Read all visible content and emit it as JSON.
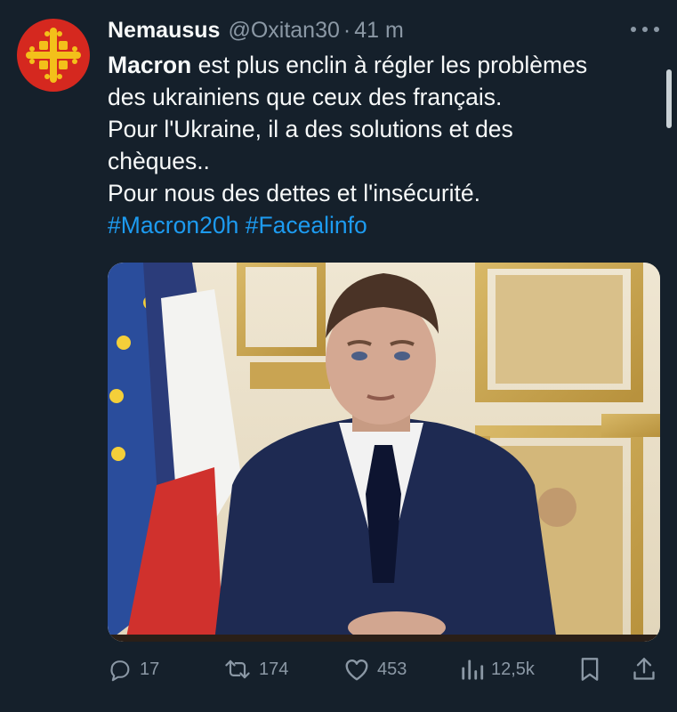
{
  "tweet": {
    "author_name": "Nemausus",
    "handle": "@Oxitan30",
    "separator": "·",
    "time": "41 m",
    "text_bold": "Macron",
    "text_line1_rest": " est plus enclin à régler les problèmes",
    "text_line2": "des ukrainiens que ceux des français.",
    "text_line3": "Pour l'Ukraine, il a des solutions et des",
    "text_line4": "chèques..",
    "text_line5": "Pour nous des dettes et l'insécurité.",
    "hashtag1": "#Macron20h",
    "hashtag2": "#Facealinfo"
  },
  "avatar": {
    "icon": "occitan-cross-icon",
    "color": "#d5281f",
    "cross_color": "#f3c01a"
  },
  "actions": {
    "replies": "17",
    "retweets": "174",
    "likes": "453",
    "views": "12,5k"
  },
  "colors": {
    "background": "#15202b",
    "text": "#f7f9f9",
    "muted": "#8b98a5",
    "link": "#1d9bf0"
  }
}
